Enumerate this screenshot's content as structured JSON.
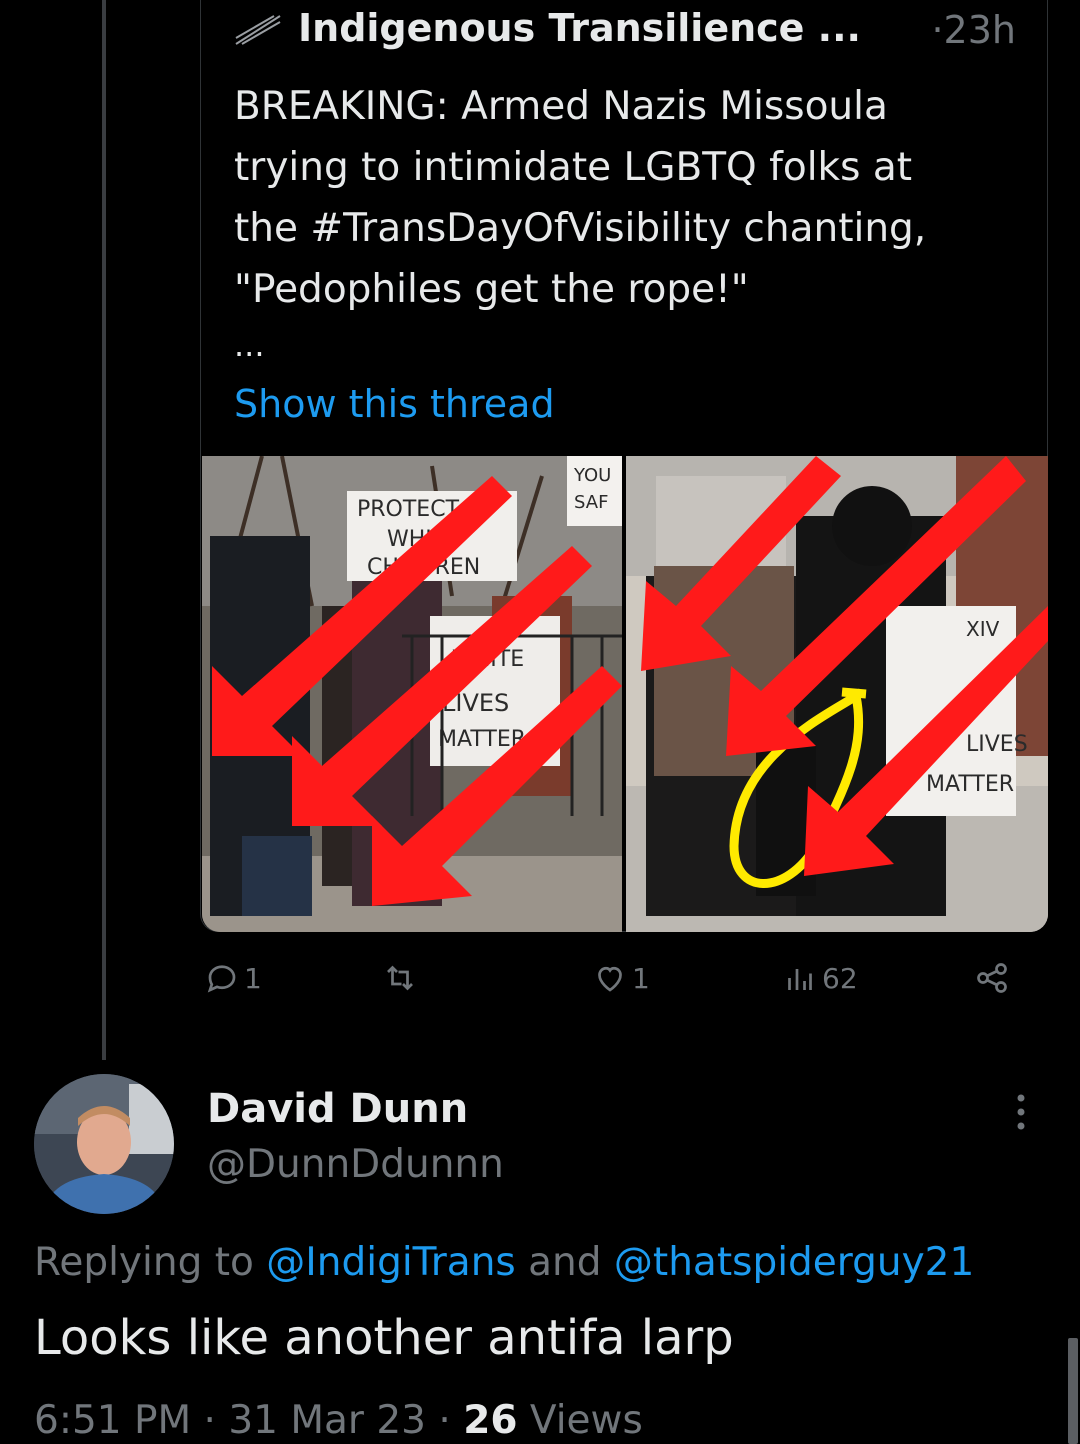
{
  "quoted_tweet": {
    "author_name": "Indigenous Transilience ...",
    "time": "·23h",
    "text": "BREAKING: Armed Nazis Missoula\ntrying to intimidate LGBTQ folks at\nthe #TransDayOfVisibility chanting,\n\"Pedophiles get the rope!\"",
    "ellipsis": "...",
    "show_thread": "Show this thread",
    "signs_left": [
      "PROTECT",
      "WHITE",
      "CHILDREN",
      "WHITE",
      "LIVES",
      "MATTER",
      "YOU",
      "SAF"
    ],
    "signs_right": [
      "XIV",
      "LIVES",
      "MATTER"
    ],
    "actions": {
      "replies": "1",
      "retweets": "",
      "likes": "1",
      "views": "62"
    }
  },
  "reply_tweet": {
    "author_name": "David Dunn",
    "handle": "@DunnDdunnn",
    "replying_prefix": "Replying to ",
    "mention_1": "@IndigiTrans",
    "replying_and": " and ",
    "mention_2": "@thatspiderguy21",
    "text": "Looks like another antifa larp",
    "time": "6:51 PM",
    "date": "31 Mar 23",
    "views_count": "26",
    "views_label": "Views",
    "separator": " · "
  },
  "colors": {
    "background": "#000000",
    "text": "#e7e9ea",
    "secondary": "#71767b",
    "link": "#1d9bf0",
    "annotation_red": "#ff1a1a",
    "annotation_yellow": "#ffea00"
  }
}
